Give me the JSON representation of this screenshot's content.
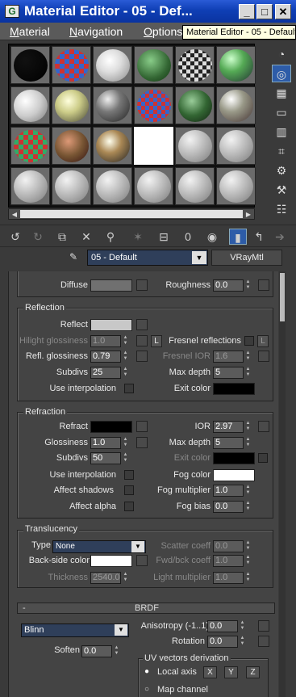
{
  "window": {
    "title": "Material Editor - 05 - Def...",
    "app_icon": "3ds-max-icon"
  },
  "menu": [
    "Material",
    "Navigation",
    "Options"
  ],
  "tooltip": "Material Editor - 05 - Default",
  "material": {
    "name": "05 - Default",
    "type": "VRayMtl"
  },
  "toolbar_value": "0",
  "diffuse": {
    "label": "Diffuse",
    "color": "#707070",
    "roughness_label": "Roughness",
    "roughness": "0.0"
  },
  "reflection": {
    "title": "Reflection",
    "reflect_label": "Reflect",
    "reflect_color": "#c8c8c8",
    "hilight_label": "Hilight glossiness",
    "hilight": "1.0",
    "l_button": "L",
    "fresnel_label": "Fresnel reflections",
    "fresnel_l": "L",
    "refl_gloss_label": "Refl. glossiness",
    "refl_gloss": "0.79",
    "fresnel_ior_label": "Fresnel IOR",
    "fresnel_ior": "1.6",
    "subdivs_label": "Subdivs",
    "subdivs": "25",
    "max_depth_label": "Max depth",
    "max_depth": "5",
    "use_interp_label": "Use interpolation",
    "exit_color_label": "Exit color",
    "exit_color": "#000000"
  },
  "refraction": {
    "title": "Refraction",
    "refract_label": "Refract",
    "refract_color": "#000000",
    "ior_label": "IOR",
    "ior": "2.97",
    "gloss_label": "Glossiness",
    "gloss": "1.0",
    "max_depth_label": "Max depth",
    "max_depth": "5",
    "subdivs_label": "Subdivs",
    "subdivs": "50",
    "exit_color_label": "Exit color",
    "exit_color": "#000000",
    "use_interp_label": "Use interpolation",
    "fog_color_label": "Fog color",
    "fog_color": "#ffffff",
    "affect_shadows_label": "Affect shadows",
    "fog_mult_label": "Fog multiplier",
    "fog_mult": "1.0",
    "affect_alpha_label": "Affect alpha",
    "fog_bias_label": "Fog bias",
    "fog_bias": "0.0"
  },
  "translucency": {
    "title": "Translucency",
    "type_label": "Type",
    "type_value": "None",
    "scatter_label": "Scatter coeff",
    "scatter": "0.0",
    "backside_label": "Back-side color",
    "backside_color": "#ffffff",
    "fwd_label": "Fwd/bck coeff",
    "fwd": "1.0",
    "thickness_label": "Thickness",
    "thickness": "2540.0",
    "light_mult_label": "Light multiplier",
    "light_mult": "1.0"
  },
  "brdf": {
    "collapse": "-",
    "title": "BRDF",
    "type": "Blinn",
    "anisotropy_label": "Anisotropy (-1..1)",
    "anisotropy": "0.0",
    "rotation_label": "Rotation",
    "rotation": "0.0",
    "soften_label": "Soften",
    "soften": "0.0",
    "uv_label": "UV vectors derivation",
    "local_axis_label": "Local axis",
    "axes": [
      "X",
      "Y",
      "Z"
    ],
    "map_channel_label": "Map channel"
  }
}
